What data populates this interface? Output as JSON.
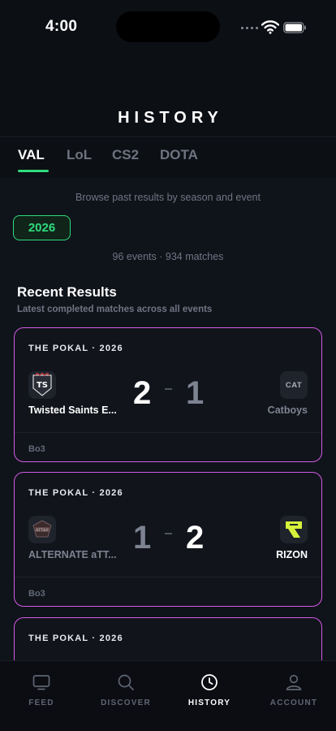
{
  "status": {
    "time": "4:00"
  },
  "header": {
    "title": "HISTORY"
  },
  "tabs": [
    {
      "label": "VAL",
      "active": true
    },
    {
      "label": "LoL",
      "active": false
    },
    {
      "label": "CS2",
      "active": false
    },
    {
      "label": "DOTA",
      "active": false
    }
  ],
  "subtitle": "Browse past results by season and event",
  "season": "2026",
  "summary": "96 events · 934 matches",
  "recent": {
    "title": "Recent Results",
    "subtitle": "Latest completed matches across all events"
  },
  "matches": [
    {
      "event": "THE POKAL · 2026",
      "team1": {
        "name": "Twisted Saints E...",
        "score": "2",
        "logo": "twisted-saints-logo"
      },
      "team2": {
        "name": "Catboys",
        "score": "1",
        "logo_text": "CAT"
      },
      "format": "Bo3",
      "winner": "team1"
    },
    {
      "event": "THE POKAL · 2026",
      "team1": {
        "name": "ALTERNATE aTT...",
        "score": "1",
        "logo": "alternate-attax-logo"
      },
      "team2": {
        "name": "RIZON",
        "score": "2",
        "logo": "rizon-logo"
      },
      "format": "Bo3",
      "winner": "team2"
    },
    {
      "event": "THE POKAL · 2026"
    }
  ],
  "nav": [
    {
      "label": "FEED",
      "icon": "tv-icon",
      "active": false
    },
    {
      "label": "DISCOVER",
      "icon": "search-icon",
      "active": false
    },
    {
      "label": "HISTORY",
      "icon": "clock-icon",
      "active": true
    },
    {
      "label": "ACCOUNT",
      "icon": "user-icon",
      "active": false
    }
  ],
  "colors": {
    "accent_green": "#2fdc7c",
    "card_border": "#d45be8",
    "background": "#0c0f14"
  }
}
